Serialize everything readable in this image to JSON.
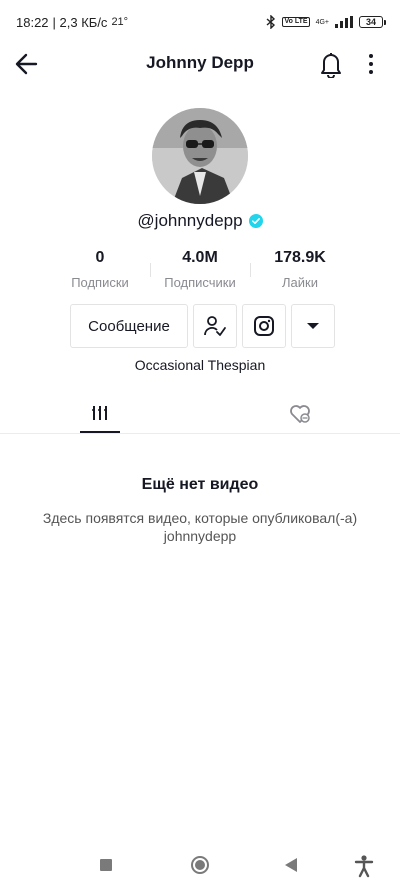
{
  "status_bar": {
    "time": "18:22",
    "network_speed": "| 2,3 КБ/с",
    "temperature": "21°",
    "network_type": "4G+",
    "lte_label": "Vo LTE",
    "battery": "34"
  },
  "header": {
    "title": "Johnny Depp",
    "icons": [
      "back-arrow-icon",
      "bell-icon",
      "more-vertical-icon"
    ]
  },
  "profile": {
    "username": "@johnnydepp",
    "verified": true,
    "bio": "Occasional Thespian",
    "stats": [
      {
        "value": "0",
        "label": "Подписки"
      },
      {
        "value": "4.0M",
        "label": "Подписчики"
      },
      {
        "value": "178.9K",
        "label": "Лайки"
      }
    ]
  },
  "actions": {
    "message_label": "Сообщение",
    "icons": [
      "user-check-icon",
      "instagram-icon",
      "dropdown-caret-icon"
    ]
  },
  "tabs": {
    "items": [
      "videos-grid-icon",
      "liked-hidden-icon"
    ],
    "active": 0
  },
  "empty_state": {
    "title": "Ещё нет видео",
    "description": "Здесь появятся видео, которые опубликовал(-а) johnnydepp"
  },
  "colors": {
    "text": "#161823",
    "secondary": "#8a8b91",
    "verified": "#20d5ec",
    "border": "#e3e3e4"
  }
}
